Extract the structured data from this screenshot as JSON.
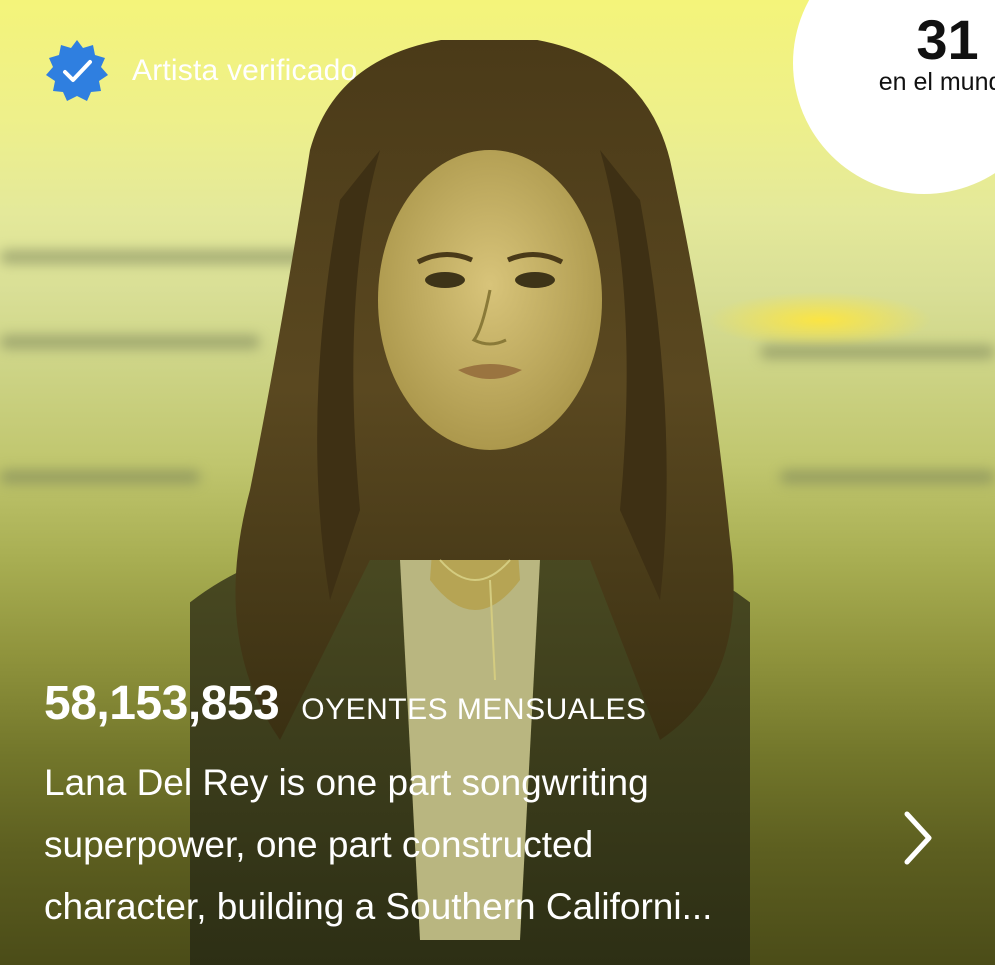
{
  "badge": {
    "icon": "verified-badge-icon",
    "label": "Artista verificado",
    "color": "#2f7fe0"
  },
  "rank": {
    "number": "31",
    "caption": "en el mundo"
  },
  "listeners": {
    "count": "58,153,853",
    "label": "OYENTES MENSUALES"
  },
  "bio": {
    "text": "Lana Del Rey is one part songwriting\nsuperpower, one part constructed\ncharacter, building a Southern Californi..."
  },
  "more": {
    "icon": "chevron-right-icon"
  }
}
